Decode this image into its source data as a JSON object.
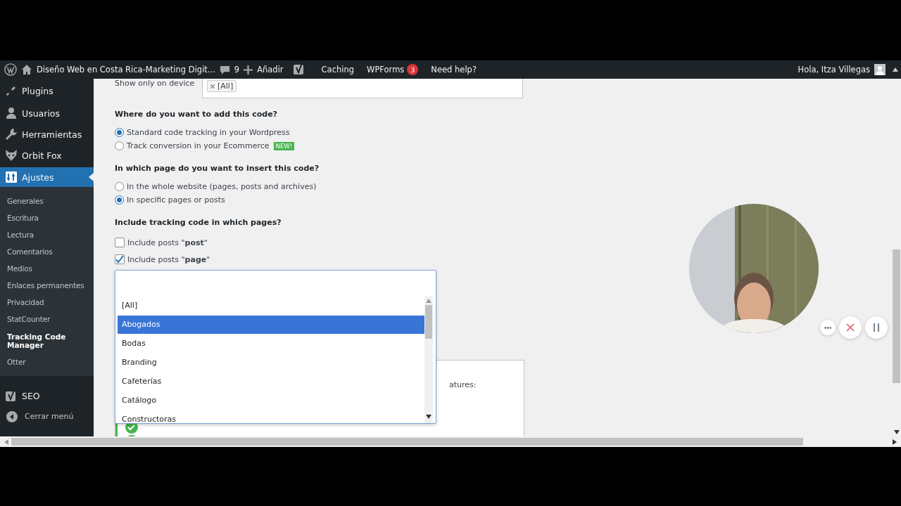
{
  "admin_bar": {
    "site_title": "Diseño Web en Costa Rica-Marketing Digit...",
    "comments": "9",
    "new": "Añadir",
    "links": [
      {
        "label": "Caching"
      },
      {
        "label": "WPForms",
        "badge": "3"
      },
      {
        "label": "Need help?"
      }
    ],
    "account": "Hola, Itza Villegas"
  },
  "sidebar": {
    "items": [
      {
        "kind": "top",
        "label": "Plugins",
        "selected": false
      },
      {
        "kind": "top",
        "label": "Usuarios",
        "selected": false
      },
      {
        "kind": "top",
        "label": "Herramientas",
        "selected": false
      },
      {
        "kind": "top",
        "label": "Orbit Fox",
        "selected": false
      },
      {
        "kind": "top",
        "label": "Ajustes",
        "selected": true,
        "children": [
          {
            "label": "Generales",
            "selected": false
          },
          {
            "label": "Escritura",
            "selected": false
          },
          {
            "label": "Lectura",
            "selected": false
          },
          {
            "label": "Comentarios",
            "selected": false
          },
          {
            "label": "Medios",
            "selected": false
          },
          {
            "label": "Enlaces permanentes",
            "selected": false
          },
          {
            "label": "Privacidad",
            "selected": false
          },
          {
            "label": "StatCounter",
            "selected": false
          },
          {
            "label": "Tracking Code Manager",
            "selected": true
          },
          {
            "label": "Otter",
            "selected": false
          }
        ]
      },
      {
        "kind": "seo",
        "label": "SEO",
        "selected": false
      },
      {
        "kind": "collapse",
        "label": "Cerrar menú",
        "selected": false
      }
    ]
  },
  "form": {
    "device": {
      "label": "Show only on device",
      "tags": [
        "[All]"
      ]
    },
    "sections": [
      {
        "kind": "radio",
        "heading": "Where do you want to add this code?",
        "options": [
          {
            "label": "Standard code tracking in your Wordpress",
            "selected": true
          },
          {
            "label": "Track conversion in your Ecommerce",
            "badge": "NEW!",
            "selected": false
          }
        ]
      },
      {
        "kind": "radio",
        "heading": "In which page do you want to insert this code?",
        "options": [
          {
            "label": "In the whole website (pages, posts and archives)",
            "selected": false
          },
          {
            "label": "In specific pages or posts",
            "selected": true
          }
        ]
      },
      {
        "kind": "checkbox",
        "heading": "Include tracking code in which pages?",
        "options": [
          {
            "label": "Include posts \"**post**\"",
            "checked": false
          },
          {
            "label": "Include posts \"**page**\"",
            "checked": true
          }
        ]
      }
    ]
  },
  "dropdown": {
    "options": [
      {
        "label": "[All]",
        "selected": false
      },
      {
        "label": "Abogados",
        "selected": true
      },
      {
        "label": "Bodas",
        "selected": false
      },
      {
        "label": "Branding",
        "selected": false
      },
      {
        "label": "Cafeterías",
        "selected": false
      },
      {
        "label": "Catálogo",
        "selected": false
      },
      {
        "label": "Constructoras",
        "selected": false
      }
    ]
  },
  "card": {
    "text": "atures:"
  }
}
